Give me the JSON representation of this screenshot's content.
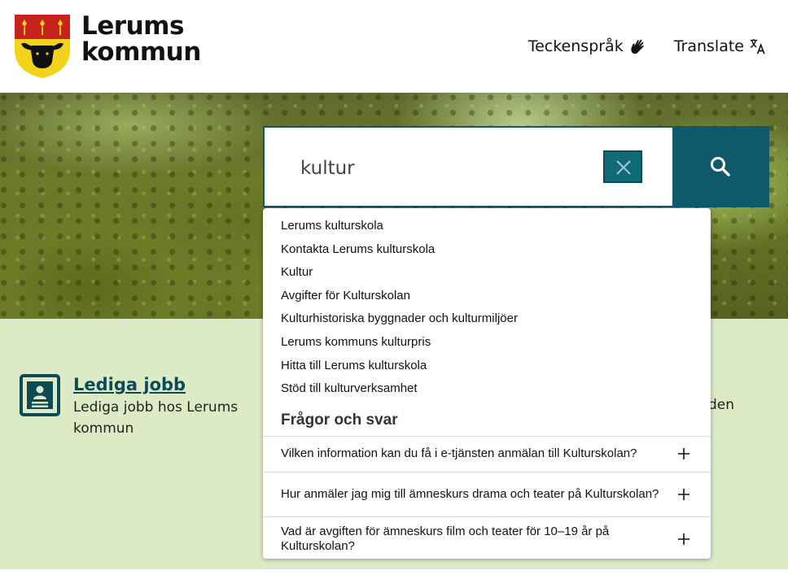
{
  "header": {
    "logo_line1": "Lerums",
    "logo_line2": "kommun",
    "links": [
      {
        "label": "Teckenspråk",
        "icon": "sign-language-hand-icon"
      },
      {
        "label": "Translate",
        "icon": "translate-icon"
      }
    ]
  },
  "search": {
    "value": "kultur",
    "clear_icon": "close-icon",
    "submit_icon": "search-icon",
    "accent_color": "#0e5a6a"
  },
  "suggestions": [
    "Lerums kulturskola",
    "Kontakta Lerums kulturskola",
    "Kultur",
    "Avgifter för Kulturskolan",
    "Kulturhistoriska byggnader och kulturmiljöer",
    "Lerums kommuns kulturpris",
    "Hitta till Lerums kulturskola",
    "Stöd till kulturverksamhet"
  ],
  "faq": {
    "heading": "Frågor och svar",
    "items": [
      "Vilken information kan du få i e-tjänsten anmälan till Kulturskolan?",
      "Hur anmäler jag mig till ämneskurs drama och teater på Kulturskolan?",
      "Vad är avgiften för ämneskurs film och teater för 10–19 år på Kulturskolan?"
    ]
  },
  "cards": {
    "jobs": {
      "title": "Lediga jobb",
      "description": "Lediga jobb hos Lerums kommun",
      "icon": "document-person-icon"
    },
    "right_fragment": "den"
  },
  "colors": {
    "band_background": "#dceac6",
    "link_color": "#0d4a55"
  }
}
